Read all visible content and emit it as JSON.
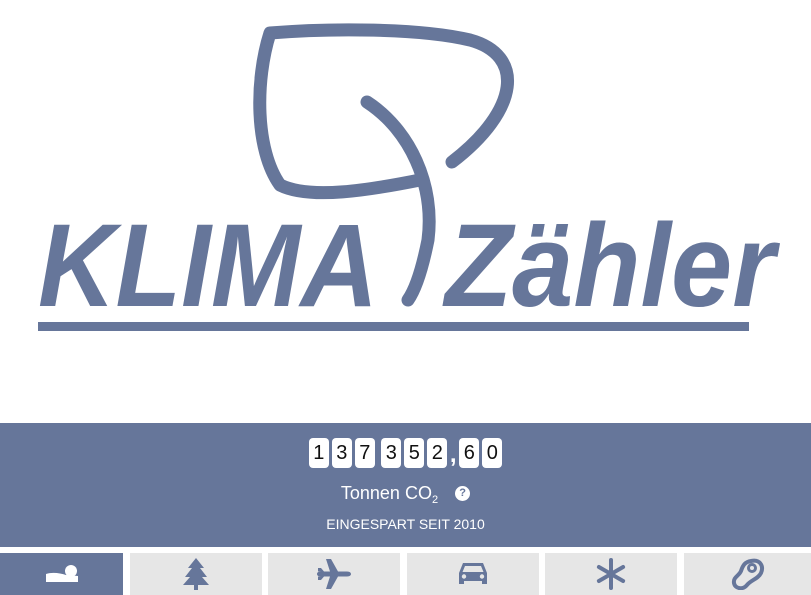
{
  "logo": {
    "word_left": "KLIMA",
    "word_right": "Zähler",
    "color": "#66769a"
  },
  "counter": {
    "digits_group1": [
      "1",
      "3",
      "7"
    ],
    "digits_group2": [
      "3",
      "5",
      "2"
    ],
    "decimal_separator": ",",
    "digits_decimal": [
      "6",
      "0"
    ],
    "unit_text": "Tonnen CO",
    "unit_subscript": "2",
    "help_label": "?",
    "since_text": "EINGESPART SEIT 2010",
    "panel_color": "#66769a"
  },
  "tabs": [
    {
      "icon": "sleeping-icon",
      "active": true
    },
    {
      "icon": "tree-icon",
      "active": false
    },
    {
      "icon": "airplane-icon",
      "active": false
    },
    {
      "icon": "car-icon",
      "active": false
    },
    {
      "icon": "snowflake-icon",
      "active": false
    },
    {
      "icon": "steak-icon",
      "active": false
    }
  ]
}
